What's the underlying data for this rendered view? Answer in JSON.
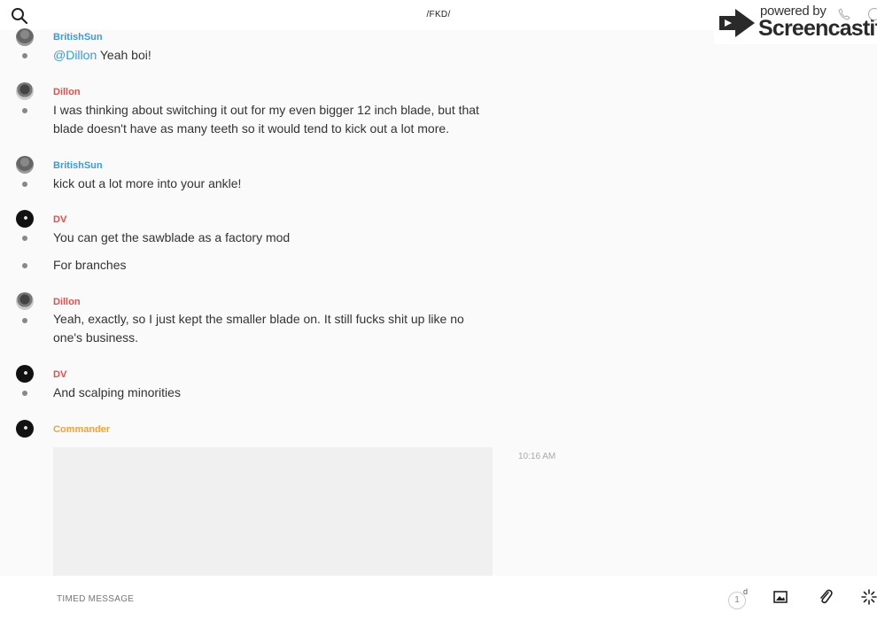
{
  "header": {
    "channel_title": "/FKD/",
    "search_icon": "search-icon"
  },
  "watermark": {
    "powered_by": "powered by",
    "brand": "Screencastify"
  },
  "messages": [
    {
      "username": "BritishSun",
      "color": "#3e9ad2",
      "lines": [
        {
          "mention": "@Dillon",
          "text": " Yeah boi!"
        }
      ]
    },
    {
      "username": "Dillon",
      "color": "#d9534f",
      "lines": [
        {
          "text": "I was thinking about switching it out for my even bigger 12 inch blade, but that blade doesn't have as many teeth so it would tend to kick out a lot more."
        }
      ]
    },
    {
      "username": "BritishSun",
      "color": "#3e9ad2",
      "lines": [
        {
          "text": "kick out a lot more into your ankle!"
        }
      ]
    },
    {
      "username": "DV",
      "color": "#d9534f",
      "lines": [
        {
          "text": "You can get the sawblade as a factory mod"
        },
        {
          "text": "For branches"
        }
      ]
    },
    {
      "username": "Dillon",
      "color": "#d9534f",
      "lines": [
        {
          "text": "Yeah, exactly, so I just kept the smaller blade on. It still fucks shit up like no one's business."
        }
      ]
    },
    {
      "username": "DV",
      "color": "#d9534f",
      "lines": [
        {
          "text": "And scalping minorities"
        }
      ]
    },
    {
      "username": "Commander",
      "color": "#f0a437",
      "timestamp": "10:16 AM"
    }
  ],
  "composer": {
    "placeholder": "TIMED MESSAGE",
    "timer_value": "1",
    "timer_unit": "d"
  }
}
